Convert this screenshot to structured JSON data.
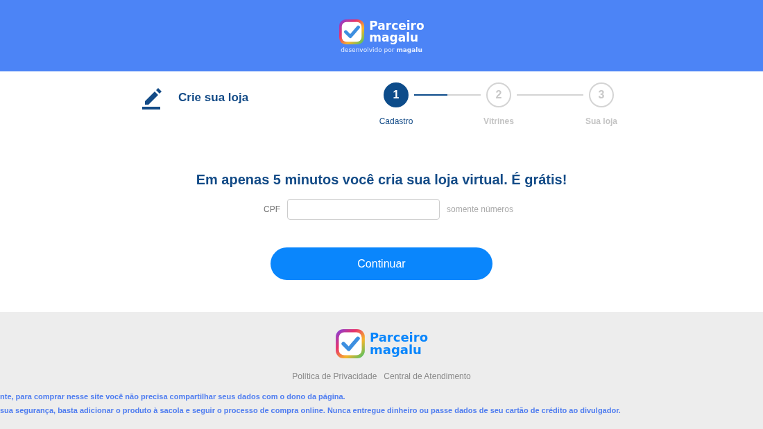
{
  "header": {
    "brand_line_1": "Parceiro",
    "brand_line_2": "magalu",
    "tagline": "desenvolvido por",
    "tagline_brand": "magalu"
  },
  "page_title": "Crie sua loja",
  "steps": [
    {
      "number": "1",
      "label": "Cadastro",
      "selected": true
    },
    {
      "number": "2",
      "label": "Vitrines",
      "selected": false
    },
    {
      "number": "3",
      "label": "Sua loja",
      "selected": false
    }
  ],
  "connectors": [
    {
      "level": 0.5
    },
    {
      "level": 0
    }
  ],
  "headline": "Em apenas 5 minutos você cria sua loja virtual. É grátis!",
  "cpf": {
    "label": "CPF",
    "hint": "somente números"
  },
  "continue_button": "Continuar",
  "footer": {
    "brand_line_1": "Parceiro",
    "brand_line_2": "magalu",
    "links": [
      "Política de Privacidade",
      "Central de Atendimento"
    ],
    "notices": [
      "nte, para comprar nesse site você não precisa compartilhar seus dados com o dono da página.",
      "sua segurança, basta adicionar o produto à sacola e seguir o processo de compra online. Nunca entregue dinheiro ou passe dados de seu cartão de crédito ao divulgador."
    ]
  }
}
